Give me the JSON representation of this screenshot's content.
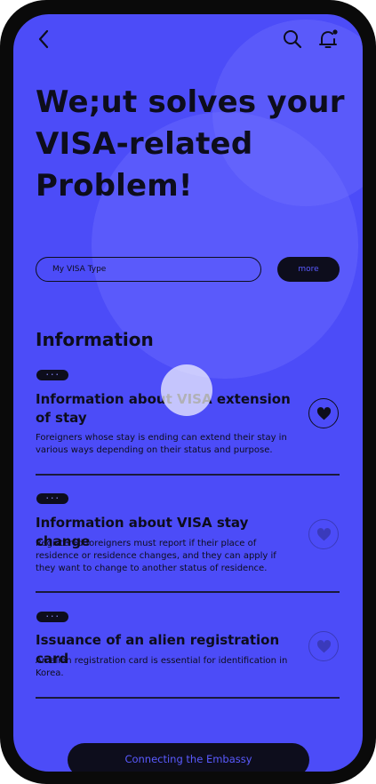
{
  "header": {
    "back_icon": "chevron-left-icon",
    "search_icon": "search-icon",
    "notification_icon": "bell-icon"
  },
  "hero": {
    "headline": "We;ut solves your VISA-related Problem!"
  },
  "search": {
    "placeholder": "My VISA Type",
    "more_label": "more"
  },
  "section": {
    "title": "Information"
  },
  "items": [
    {
      "tag": "• • •",
      "title": "Information about VISA extension of stay",
      "description": "Foreigners whose stay is ending can extend their stay in various ways depending on their status and purpose.",
      "liked": true
    },
    {
      "tag": "• • •",
      "title": "Information about VISA stay change",
      "description": "Registered foreigners must report if their place of residence or residence changes, and they can apply if they want to change to another status of residence.",
      "liked": false
    },
    {
      "tag": "• • •",
      "title": "Issuance of an alien registration card",
      "description": "An alien registration card is essential for identification in Korea.",
      "liked": false
    }
  ],
  "footer": {
    "cta_label": "Connecting the Embassy"
  },
  "colors": {
    "background": "#4c4cf8",
    "ink": "#0d0d1c",
    "accent": "#5a5aff"
  }
}
